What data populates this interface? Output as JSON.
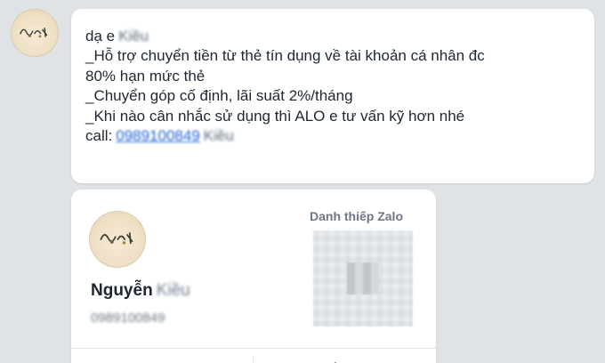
{
  "chat": {
    "sender_avatar_icon": "avatar-doodle-icon",
    "message": {
      "line1_prefix": "dạ e",
      "line1_name_blurred": "Kiều",
      "line2": "_Hỗ trợ chuyển tiền từ thẻ tín dụng về tài khoản cá nhân đc",
      "line3": "80% hạn mức thẻ",
      "line4": "_Chuyển góp cố định, lãi suất 2%/tháng",
      "line5": "_Khi nào cân nhắc sử dụng thì ALO e tư vấn kỹ hơn nhé",
      "line6_prefix": "call:",
      "line6_phone": "0989100849",
      "line6_name_blurred": "Kiều"
    },
    "contact_card": {
      "label": "Danh thiếp Zalo",
      "name_first": "Nguyễn",
      "name_blurred": "Kiều",
      "phone": "0989100849",
      "avatar_icon": "avatar-doodle-icon",
      "qr_icon": "qr-code-icon"
    }
  }
}
